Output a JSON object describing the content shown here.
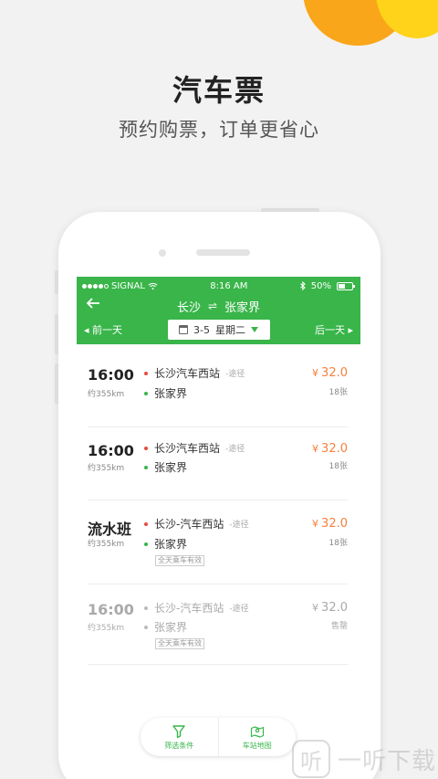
{
  "promo": {
    "title": "汽车票",
    "subtitle": "预约购票，订单更省心"
  },
  "status_bar": {
    "carrier": "SIGNAL",
    "time": "8:16 AM",
    "battery": "50%"
  },
  "header": {
    "from": "长沙",
    "swap_glyph": "⇌",
    "to": "张家界",
    "prev_day": "前一天",
    "next_day": "后一天",
    "date": "3-5",
    "weekday": "星期二"
  },
  "trips": [
    {
      "time": "16:00",
      "distance": "约355km",
      "origin": "长沙汽车西站",
      "via": "-途径",
      "destination": "张家界",
      "currency": "¥",
      "price": "32.0",
      "seats": "18张",
      "tag": "",
      "disabled": false
    },
    {
      "time": "16:00",
      "distance": "约355km",
      "origin": "长沙汽车西站",
      "via": "-途径",
      "destination": "张家界",
      "currency": "¥",
      "price": "32.0",
      "seats": "18张",
      "tag": "",
      "disabled": false
    },
    {
      "time": "流水班",
      "distance": "约355km",
      "origin": "长沙-汽车西站",
      "via": "-途径",
      "destination": "张家界",
      "currency": "¥",
      "price": "32.0",
      "seats": "18张",
      "tag": "全天乘车有效",
      "disabled": false
    },
    {
      "time": "16:00",
      "distance": "约355km",
      "origin": "长沙-汽车西站",
      "via": "-途径",
      "destination": "张家界",
      "currency": "¥",
      "price": "32.0",
      "seats": "售罄",
      "tag": "全天乘车有效",
      "disabled": true
    }
  ],
  "bottom_bar": {
    "filter_label": "筛选条件",
    "map_label": "车站地图"
  },
  "watermark": {
    "logo": "听",
    "text": "一听下载"
  },
  "colors": {
    "primary": "#39b54a",
    "price": "#f5803e",
    "origin_dot": "#e94a3e",
    "background": "#f2f2f2"
  }
}
